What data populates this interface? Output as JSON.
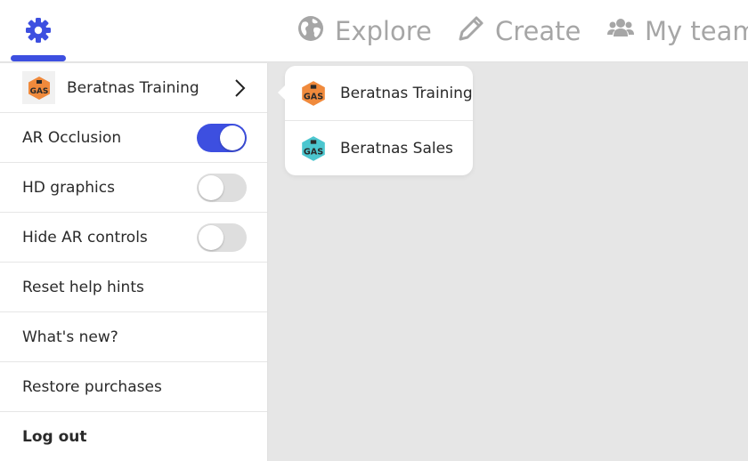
{
  "nav": {
    "explore_label": "Explore",
    "create_label": "Create",
    "team_label": "My team",
    "active_color": "#3d4fe0",
    "inactive_color": "#a6a6a6"
  },
  "menu": {
    "team": {
      "name": "Beratnas Training",
      "logo_text": "GAS"
    },
    "ar_occlusion": {
      "label": "AR Occlusion",
      "enabled": true
    },
    "hd_graphics": {
      "label": "HD graphics",
      "enabled": false
    },
    "hide_ar_controls": {
      "label": "Hide AR controls",
      "enabled": false
    },
    "reset_help_hints": "Reset help hints",
    "whats_new": "What's new?",
    "restore_purchases": "Restore purchases",
    "log_out": "Log out"
  },
  "popover": {
    "items": [
      {
        "name": "Beratnas Training",
        "logo_text": "GAS",
        "logo_color": "#f08a3c"
      },
      {
        "name": "Beratnas Sales",
        "logo_text": "GAS",
        "logo_color": "#4cc6cf"
      }
    ]
  }
}
